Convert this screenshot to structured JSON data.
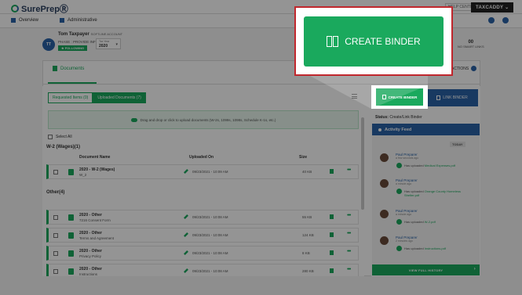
{
  "app": {
    "logo": "SurePrepⓇ",
    "help_label": "HELP CENTER",
    "user_menu": "TAXCADDY"
  },
  "nav": {
    "overview": "Overview",
    "administrative": "Administrative"
  },
  "client": {
    "initials": "TT",
    "name": "Tom Taxpayer",
    "account": "SOFTLINE ACCOUNT",
    "phase": "PHASE : PROVIDE INFO",
    "following": "FOLLOWING",
    "tax_year_label": "Tax Year",
    "tax_year": "2020",
    "stat_value": "00",
    "stat_label": "NO SMART LINKS"
  },
  "tabs": {
    "documents": "Documents",
    "actions": "ACTIONS"
  },
  "subtabs": {
    "requested": "Requested Items (0)",
    "uploaded": "Uploaded Documents (7)"
  },
  "dropzone": "Drag and drop or click to upload documents (W-2s, 1099s, 1098s, Schedule K-1s, etc.)",
  "select_all": "Select All",
  "columns": {
    "name": "Document Name",
    "uploaded": "Uploaded On",
    "size": "Size"
  },
  "groups": [
    {
      "title": "W-2 (Wages)(1)",
      "rows": [
        {
          "name": "2020 - W-2 (Wages)",
          "sub": "W_2",
          "date": "09/23/2021 - 10:09 AM",
          "size": "40 KB"
        }
      ]
    },
    {
      "title": "Other(4)",
      "rows": [
        {
          "name": "2020 - Other",
          "sub": "7216 Consent Form",
          "date": "09/23/2021 - 10:08 AM",
          "size": "55 KB"
        },
        {
          "name": "2020 - Other",
          "sub": "Terms and Agreement",
          "date": "09/23/2021 - 10:08 AM",
          "size": "124 KB"
        },
        {
          "name": "2020 - Other",
          "sub": "Privacy Policy",
          "date": "09/23/2021 - 10:08 AM",
          "size": "8 KB"
        },
        {
          "name": "2020 - Other",
          "sub": "Instructions",
          "date": "09/23/2021 - 10:08 AM",
          "size": "280 KB"
        }
      ]
    }
  ],
  "right": {
    "create_binder": "CREATE BINDER",
    "link_binder": "LINK BINDER",
    "status_label": "Status:",
    "status_value": "Create/Link Binder",
    "activity_feed": "Activity Feed",
    "today": "TODAY",
    "feed": [
      {
        "user": "Paul Preparer",
        "time": "a few seconds ago",
        "text": "Has uploaded ",
        "file": "Medical Expenses.pdf"
      },
      {
        "user": "Paul Preparer",
        "time": "a minute ago",
        "text": "Has uploaded ",
        "file": "Orange County Homeless Shelter.pdf"
      },
      {
        "user": "Paul Preparer",
        "time": "a minute ago",
        "text": "Has uploaded ",
        "file": "W-2.pdf"
      },
      {
        "user": "Paul Preparer",
        "time": "2 minutes ago",
        "text": "Has uploaded ",
        "file": "Instructions.pdf"
      }
    ],
    "view_history": "VIEW FULL HISTORY"
  },
  "callout": {
    "label": "CREATE BINDER"
  },
  "colors": {
    "green": "#1aa95d",
    "blue": "#2a63a8",
    "callout_border": "#c0272d"
  }
}
